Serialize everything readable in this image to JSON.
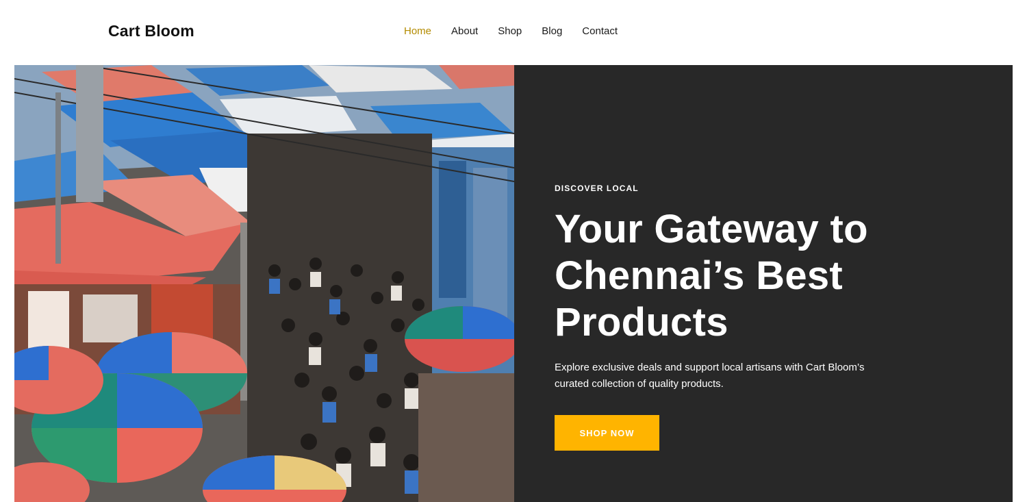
{
  "header": {
    "brand": "Cart Bloom",
    "nav": [
      {
        "label": "Home",
        "active": true
      },
      {
        "label": "About"
      },
      {
        "label": "Shop"
      },
      {
        "label": "Blog"
      },
      {
        "label": "Contact"
      }
    ]
  },
  "hero": {
    "eyebrow": "DISCOVER LOCAL",
    "headline": "Your Gateway to Chennai’s Best Products",
    "description": "Explore exclusive deals and support local artisans with Cart Bloom’s curated collection of quality products.",
    "cta_label": "SHOP NOW",
    "colors": {
      "panel": "#282828",
      "accent": "#ffb400",
      "active_nav": "#b38b00"
    }
  }
}
